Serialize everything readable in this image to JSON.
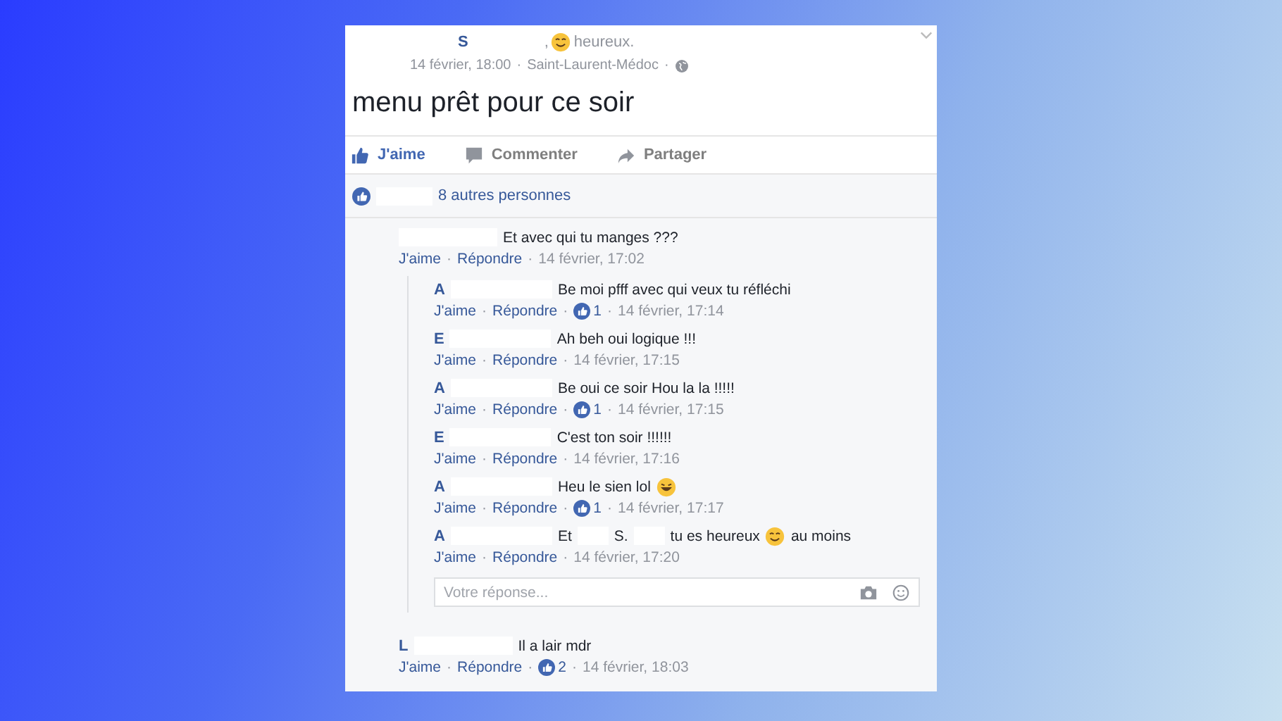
{
  "separator": "·",
  "post": {
    "author_initial": "S",
    "comma": ",",
    "feeling": "heureux.",
    "date": "14 février, 18:00",
    "location": "Saint-Laurent-Médoc",
    "text": "menu prêt pour ce soir"
  },
  "actions": [
    {
      "kind": "like",
      "label": "J'aime",
      "selected": true
    },
    {
      "kind": "comment",
      "label": "Commenter",
      "selected": false
    },
    {
      "kind": "share",
      "label": "Partager",
      "selected": false
    }
  ],
  "likes": {
    "text": "8 autres personnes"
  },
  "comments": [
    {
      "parts": [
        {
          "kind": "text",
          "text": "Et avec qui tu manges ???"
        }
      ],
      "like": "J'aime",
      "reply": "Répondre",
      "time": "14 février, 17:02",
      "replies": [
        {
          "author": "A",
          "parts": [
            {
              "kind": "text",
              "text": "Be moi pfff avec qui veux tu réfléchi"
            }
          ],
          "like": "J'aime",
          "reply": "Répondre",
          "reactions": "1",
          "time": "14 février, 17:14"
        },
        {
          "author": "E",
          "parts": [
            {
              "kind": "text",
              "text": "Ah beh oui logique !!!"
            }
          ],
          "like": "J'aime",
          "reply": "Répondre",
          "time": "14 février, 17:15"
        },
        {
          "author": "A",
          "parts": [
            {
              "kind": "text",
              "text": "Be oui ce soir Hou la la !!!!!"
            }
          ],
          "like": "J'aime",
          "reply": "Répondre",
          "reactions": "1",
          "time": "14 février, 17:15"
        },
        {
          "author": "E",
          "parts": [
            {
              "kind": "text",
              "text": "C'est ton soir !!!!!!"
            }
          ],
          "like": "J'aime",
          "reply": "Répondre",
          "time": "14 février, 17:16"
        },
        {
          "author": "A",
          "parts": [
            {
              "kind": "text",
              "text": "Heu le sien lol"
            },
            {
              "kind": "laugh"
            }
          ],
          "like": "J'aime",
          "reply": "Répondre",
          "reactions": "1",
          "time": "14 février, 17:17"
        },
        {
          "author": "A",
          "parts": [
            {
              "kind": "text",
              "text": "Et"
            },
            {
              "kind": "redaction"
            },
            {
              "kind": "text",
              "text": "S."
            },
            {
              "kind": "redaction"
            },
            {
              "kind": "text",
              "text": "tu es heureux"
            },
            {
              "kind": "smile"
            },
            {
              "kind": "text",
              "text": "au moins"
            }
          ],
          "like": "J'aime",
          "reply": "Répondre",
          "time": "14 février, 17:20"
        }
      ],
      "reply_box": {
        "placeholder": "Votre réponse..."
      }
    },
    {
      "author": "L",
      "parts": [
        {
          "kind": "text",
          "text": "Il a lair mdr"
        }
      ],
      "like": "J'aime",
      "reply": "Répondre",
      "reactions": "2",
      "time": "14 février, 18:03"
    }
  ]
}
